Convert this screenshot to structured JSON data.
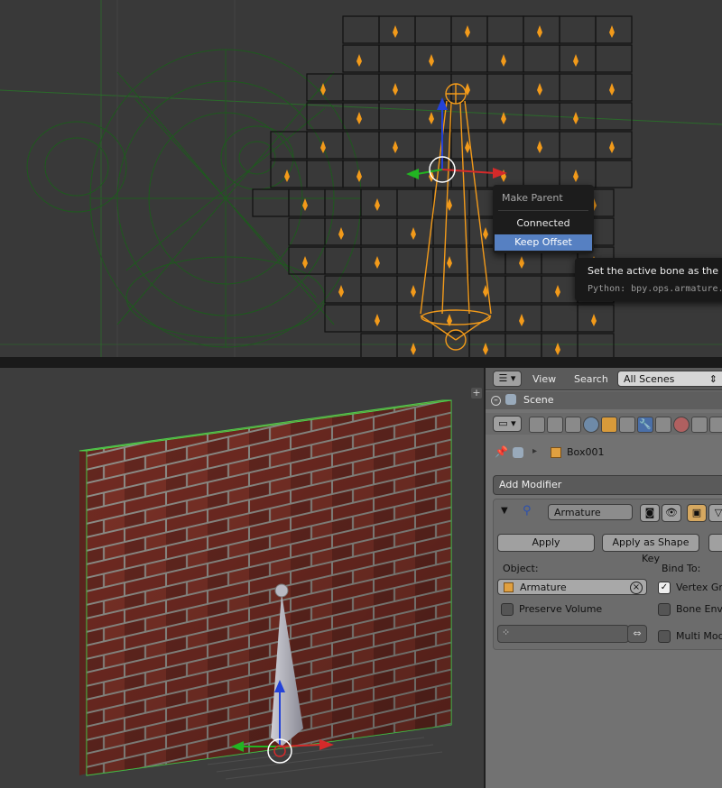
{
  "popup_menu": {
    "title": "Make Parent",
    "items": [
      "Connected",
      "Keep Offset"
    ],
    "highlighted_index": 1
  },
  "tooltip": {
    "description": "Set the active bone as the par",
    "python": "Python: bpy.ops.armature."
  },
  "properties": {
    "header": {
      "view_label": "View",
      "search_label": "Search",
      "scenes_select": "All Scenes"
    },
    "outliner_scene_label": "Scene",
    "context_path": {
      "object": "Box001"
    },
    "add_modifier_label": "Add Modifier",
    "modifier": {
      "name": "Armature",
      "apply_label": "Apply",
      "apply_shape_key_label": "Apply as Shape Key",
      "object_label": "Object:",
      "object_value": "Armature",
      "bind_to_label": "Bind To:",
      "preserve_volume_label": "Preserve Volume",
      "preserve_volume_checked": false,
      "vertex_groups_label": "Vertex Gr",
      "vertex_groups_checked": true,
      "bone_envelopes_label": "Bone Enve",
      "bone_envelopes_checked": false,
      "multi_modifier_label": "Multi Mod",
      "multi_modifier_checked": false
    }
  },
  "colors": {
    "selection_orange": "#f29a1a",
    "wireframe_green": "#1e5a1e",
    "menu_highlight": "#5680c2",
    "panel_bg": "#727272"
  }
}
